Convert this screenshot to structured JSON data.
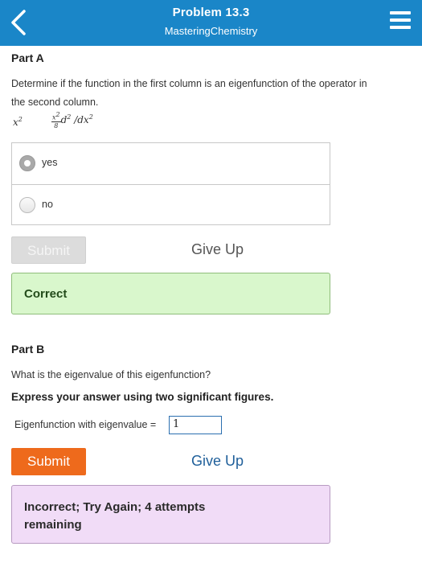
{
  "header": {
    "title": "Problem 13.3",
    "subtitle": "MasteringChemistry",
    "back_icon": "chevron-left-icon",
    "menu_icon": "hamburger-menu-icon",
    "bg_color": "#1a86c8"
  },
  "part_a": {
    "title": "Part A",
    "prompt_line1": "Determine if the function in the first column is an eigenfunction of the operator in",
    "prompt_line2": "the second column.",
    "function_base": "x",
    "function_exp": "2",
    "operator_frac_num": "x",
    "operator_frac_num_exp": "2",
    "operator_frac_den": "8",
    "operator_d": "d",
    "operator_d_exp": "2",
    "operator_slash": " /",
    "operator_dx": "dx",
    "operator_dx_exp": "2",
    "choices": [
      {
        "label": "yes",
        "selected": true
      },
      {
        "label": "no",
        "selected": false
      }
    ],
    "submit_label": "Submit",
    "giveup_label": "Give Up",
    "feedback": "Correct",
    "feedback_color": "#d9f7cc"
  },
  "part_b": {
    "title": "Part B",
    "question": "What is the eigenvalue of this eigenfunction?",
    "instruction": "Express your answer using two significant figures.",
    "answer_label": "Eigenfunction with eigenvalue =",
    "answer_value": "1",
    "submit_label": "Submit",
    "giveup_label": "Give Up",
    "feedback": "Incorrect; Try Again; 4 attempts remaining",
    "feedback_color": "#f1dcf7",
    "submit_color": "#ee6a1c"
  }
}
